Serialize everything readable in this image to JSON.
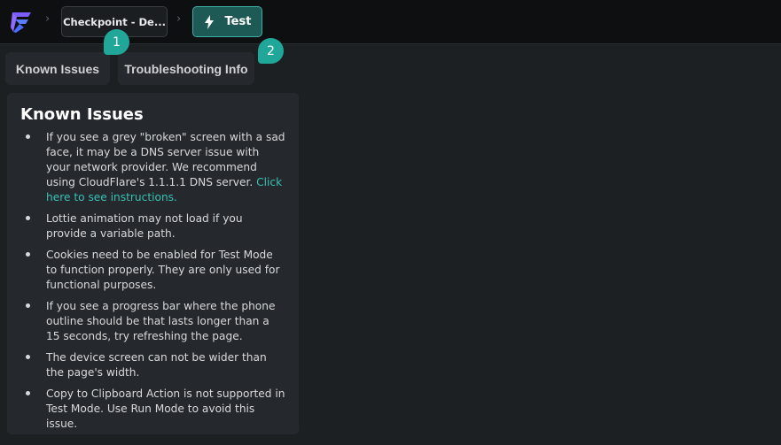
{
  "header": {
    "logo_icon": "app-logo-icon",
    "breadcrumbs": [
      {
        "label": "Checkpoint - De..."
      },
      {
        "label": "Test",
        "icon": "lightning-icon"
      }
    ]
  },
  "tabs": [
    {
      "label": "Known Issues"
    },
    {
      "label": "Troubleshooting Info"
    }
  ],
  "badges": [
    "1",
    "2"
  ],
  "panel": {
    "title": "Known Issues",
    "items": [
      {
        "text": "If you see a grey \"broken\" screen with a sad face, it may be a DNS server issue with your network provider. We recommend using CloudFlare's 1.1.1.1 DNS server. ",
        "link": "Click here to see instructions."
      },
      {
        "text": "Lottie animation may not load if you provide a variable path."
      },
      {
        "text": "Cookies need to be enabled for Test Mode to function properly. They are only used for functional purposes."
      },
      {
        "text": "If you see a progress bar where the phone outline should be that lasts longer than a 15 seconds, try refreshing the page."
      },
      {
        "text": "The device screen can not be wider than the page's width."
      },
      {
        "text": "Copy to Clipboard Action is not supported in Test Mode. Use Run Mode to avoid this issue."
      }
    ]
  },
  "colors": {
    "accent": "#21a79a",
    "link": "#37c1b3",
    "background": "#1d2023",
    "topbar": "#0d0f11",
    "panel": "#25282c"
  }
}
